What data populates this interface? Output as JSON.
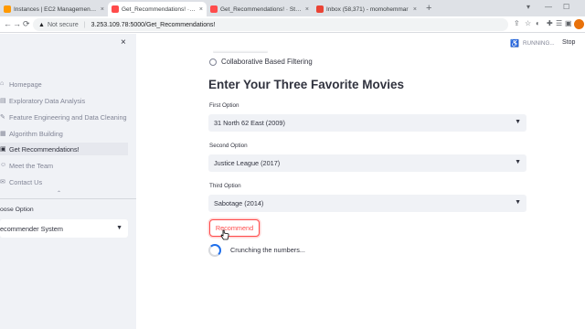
{
  "browser": {
    "tabs": [
      {
        "title": "Instances | EC2 Management Co",
        "favicon_color": "#ff9900"
      },
      {
        "title": "Get_Recommendations! · Stream",
        "favicon_color": "#ff4b4b"
      },
      {
        "title": "Get_Recommendations! · Stream",
        "favicon_color": "#ff4b4b"
      },
      {
        "title": "Inbox (58,371) - momohemmar",
        "favicon_color": "#ea4335"
      }
    ],
    "close_glyph": "×",
    "new_tab_glyph": "+",
    "window_controls": [
      "▾",
      "—",
      "☐"
    ],
    "not_secure": "Not secure",
    "url": "3.253.109.78:5000/Get_Recommendations!",
    "nav_glyphs": [
      "←",
      "→",
      "⟳"
    ],
    "toolbar_glyphs": [
      "⇪",
      "☆",
      "◐",
      "✚",
      "☰",
      "▣"
    ]
  },
  "app": {
    "status": {
      "running": "RUNNING...",
      "stop": "Stop"
    },
    "sidebar": {
      "close": "×",
      "items": [
        {
          "label": "Homepage",
          "icon": "house-icon",
          "glyph": "⌂",
          "active": false
        },
        {
          "label": "Exploratory Data Analysis",
          "icon": "chart-icon",
          "glyph": "▤",
          "active": false
        },
        {
          "label": "Feature Engineering and Data Cleaning",
          "icon": "tools-icon",
          "glyph": "✎",
          "active": false
        },
        {
          "label": "Algorithm Building",
          "icon": "building-icon",
          "glyph": "▦",
          "active": false
        },
        {
          "label": "Get Recommendations!",
          "icon": "film-icon",
          "glyph": "▣",
          "active": true
        },
        {
          "label": "Meet the Team",
          "icon": "people-icon",
          "glyph": "☺",
          "active": false
        },
        {
          "label": "Contact Us",
          "icon": "mail-icon",
          "glyph": "✉",
          "active": false
        }
      ],
      "collapse_glyph": "⌃",
      "choose_label": "oose Option",
      "choose_value": "ecommender System"
    },
    "filter_option": "Collaborative Based Filtering",
    "heading": "Enter Your Three Favorite Movies",
    "fields": [
      {
        "label": "First Option",
        "value": "31 North 62 East (2009)"
      },
      {
        "label": "Second Option",
        "value": "Justice League (2017)"
      },
      {
        "label": "Third Option",
        "value": "Sabotage (2014)"
      }
    ],
    "recommend": "Recommend",
    "spinner_text": "Crunching the numbers...",
    "colors": {
      "primary": "#ff4b4b",
      "sidebar": "#f0f2f6",
      "text": "#31333f"
    }
  }
}
